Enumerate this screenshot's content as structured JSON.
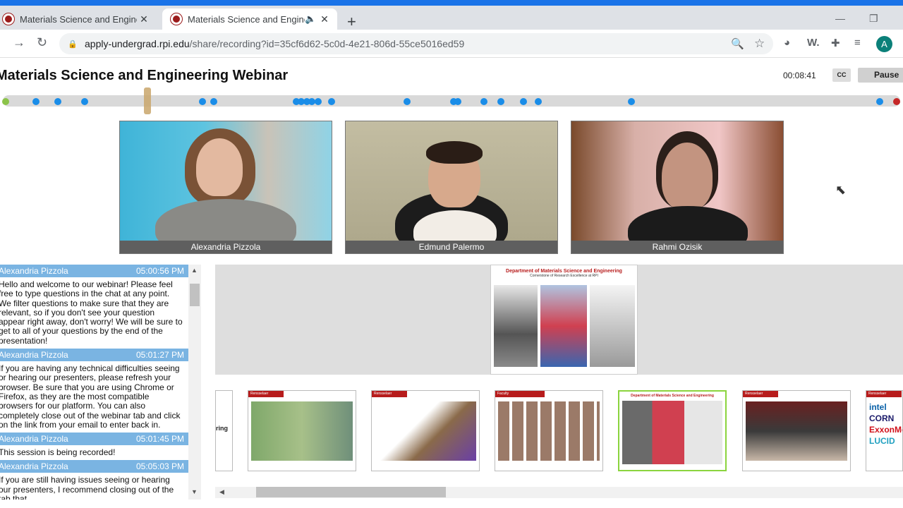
{
  "browser": {
    "tabs": [
      {
        "title": "Materials Science and Engineerin",
        "active": false
      },
      {
        "title": "Materials Science and Engine",
        "active": true,
        "audio": true
      }
    ],
    "url_host": "apply-undergrad.rpi.edu",
    "url_path": "/share/recording?id=35cf6d62-5c0d-4e21-806d-55ce5016ed59",
    "profile_initial": "A",
    "icons": [
      "back-icon",
      "forward-icon",
      "reload-icon",
      "lock-icon",
      "zoom-icon",
      "star-icon",
      "extension-icon",
      "puzzle-icon",
      "media-icon"
    ]
  },
  "page": {
    "title": "Materials Science and Engineering Webinar",
    "timer": "00:08:41",
    "cc_label": "CC",
    "pause_label": "Pause",
    "playback_position": 0.16
  },
  "participants": [
    {
      "name": "Alexandria Pizzola"
    },
    {
      "name": "Edmund Palermo"
    },
    {
      "name": "Rahmi Ozisik"
    }
  ],
  "chat": [
    {
      "author": "Alexandria Pizzola",
      "time": "05:00:56 PM",
      "text": "Hello and welcome to our webinar! Please feel free to type questions in the chat at any point. We filter questions to make sure that they are relevant, so if you don't see your question appear right away, don't worry! We will be sure to get to all of your questions by the end of the presentation!"
    },
    {
      "author": "Alexandria Pizzola",
      "time": "05:01:27 PM",
      "text": "If you are having any technical difficulties seeing or hearing our presenters, please refresh your browser. Be sure that you are using Chrome or Firefox, as they are the most compatible browsers for our platform. You can also completely close out of the webinar tab and click on the link from your email to enter back in."
    },
    {
      "author": "Alexandria Pizzola",
      "time": "05:01:45 PM",
      "text": "This session is being recorded!"
    },
    {
      "author": "Alexandria Pizzola",
      "time": "05:05:03 PM",
      "text": "If you are still having issues seeing or hearing our presenters, I recommend closing out of the tab that"
    }
  ],
  "slide": {
    "title": "Department of Materials Science and Engineering",
    "subtitle": "Cornerstone of Research Excellence at RPI"
  },
  "thumbnails": [
    {
      "label": "ring"
    },
    {
      "label": "Rensselaer"
    },
    {
      "label": "Rensselaer"
    },
    {
      "label": "Faculty"
    },
    {
      "label": "Department of Materials Science and Engineering"
    },
    {
      "label": "Rensselaer"
    },
    {
      "label": "Rensselaer"
    }
  ]
}
